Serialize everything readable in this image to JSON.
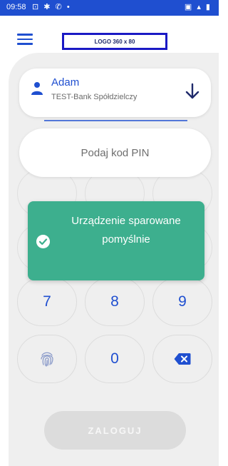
{
  "status_bar": {
    "time": "09:58",
    "left_icons": "⊡ ✱ ✆ •",
    "right_icons": "▣ ▴ ▮"
  },
  "header": {
    "logo_placeholder": "LOGO 360 x 80"
  },
  "account": {
    "name": "Adam",
    "bank": "TEST-Bank Spółdzielczy"
  },
  "pin": {
    "placeholder": "Podaj kod PIN"
  },
  "keypad": {
    "keys": [
      "7",
      "8",
      "9",
      "0"
    ],
    "fingerprint_icon": "fingerprint-icon",
    "backspace_icon": "backspace-icon"
  },
  "login_button": {
    "label": "ZALOGUJ"
  },
  "toast": {
    "message": "Urządzenie sparowane pomyślnie",
    "icon": "check-circle-icon",
    "color": "#3daf8e"
  },
  "colors": {
    "accent": "#1f4fd0",
    "panel_bg": "#efefef",
    "toast": "#3daf8e",
    "button_disabled": "#dcdcdc"
  }
}
